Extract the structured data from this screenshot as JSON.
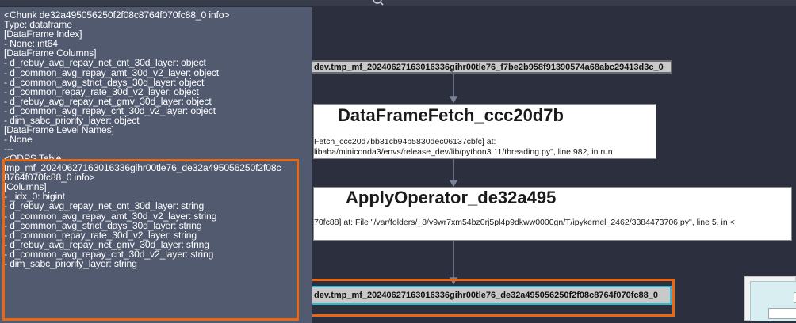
{
  "tooltip": {
    "lines": [
      "<Chunk de32a495056250f2f08c8764f070fc88_0 info>",
      "Type: dataframe",
      "[DataFrame Index]",
      "- None: int64",
      "[DataFrame Columns]",
      "- d_rebuy_avg_repay_net_cnt_30d_layer: object",
      "- d_common_avg_repay_amt_30d_v2_layer: object",
      "- d_common_avg_strict_days_30d_layer: object",
      "- d_common_repay_rate_30d_v2_layer: object",
      "- d_rebuy_avg_repay_net_gmv_30d_layer: object",
      "- d_common_avg_repay_cnt_30d_v2_layer: object",
      "- dim_sabc_priority_layer: object",
      "[DataFrame Level Names]",
      "- None",
      "---"
    ],
    "odps_lines": [
      "<ODPS Table",
      "tmp_mf_20240627163016336gihr00tle76_de32a495056250f2f08c",
      "8764f070fc88_0 info>",
      "[Columns]",
      "- _idx_0: bigint",
      "- d_rebuy_avg_repay_net_cnt_30d_layer: string",
      "- d_common_avg_repay_amt_30d_v2_layer: string",
      "- d_common_avg_strict_days_30d_layer: string",
      "- d_common_repay_rate_30d_v2_layer: string",
      "- d_rebuy_avg_repay_net_gmv_30d_layer: string",
      "- d_common_avg_repay_cnt_30d_v2_layer: string",
      "- dim_sabc_priority_layer: string"
    ]
  },
  "graph": {
    "node_top_table": "dev.tmp_mf_20240627163016336gihr00tle76_f7be2b958f91390574a68abc29413d3c_0",
    "node_fetch": {
      "title": "DataFrameFetch_ccc20d7b",
      "line1": "Fetch_ccc20d7bb31cb94b5830dec06137cbfc] at:",
      "line2": "libaba/miniconda3/envs/release_dev/lib/python3.11/threading.py\", line 982, in run"
    },
    "node_apply": {
      "title": "ApplyOperator_de32a495",
      "line1": "70fc88] at:  File \"/var/folders/_8/v9wr7xm54bz0rj5pl4p9dkww0000gn/T/ipykernel_2462/3384473706.py\", line 5, in <"
    },
    "node_bottom_table": "dev.tmp_mf_20240627163016336gihr00tle76_de32a495056250f2f08c8764f070fc88_0"
  },
  "icons": {
    "search": "search-icon",
    "minimap": "minimap-icon"
  },
  "colors": {
    "background": "#2b2f3e",
    "panel": "#525a6f",
    "highlight": "#f0660d",
    "selected_node_border": "#2bb8d0"
  }
}
